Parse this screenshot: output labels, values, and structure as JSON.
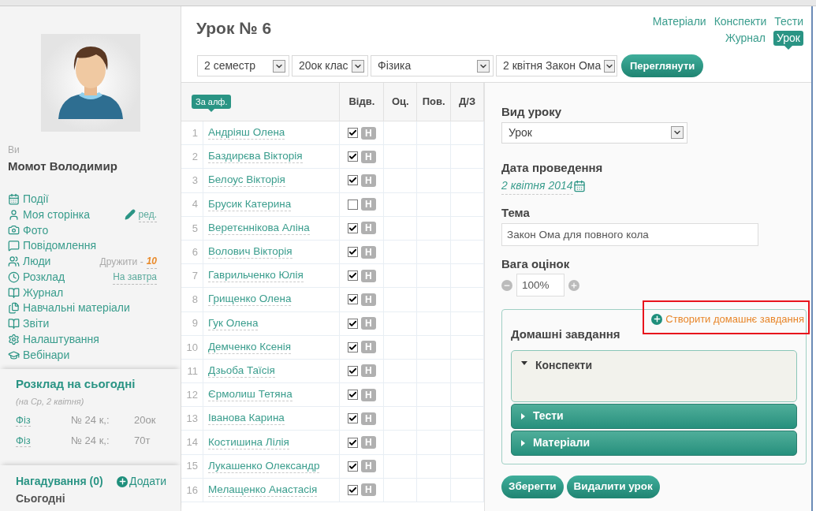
{
  "sidebar": {
    "you_label": "Ви",
    "user_name": "Момот Володимир",
    "menu": [
      {
        "label": "Події",
        "kind": "calendar"
      },
      {
        "label": "Моя сторінка",
        "kind": "person",
        "extra": {
          "kind": "edit",
          "label": "ред."
        }
      },
      {
        "label": "Фото",
        "kind": "camera"
      },
      {
        "label": "Повідомлення",
        "kind": "chat"
      },
      {
        "label": "Люди",
        "kind": "people",
        "extra": {
          "kind": "friends",
          "label": "Дружити -",
          "count": "10"
        }
      },
      {
        "label": "Розклад",
        "kind": "clock",
        "extra": {
          "kind": "link",
          "label": "На завтра"
        }
      },
      {
        "label": "Журнал",
        "kind": "book"
      },
      {
        "label": "Навчальні матеріали",
        "kind": "files"
      },
      {
        "label": "Звіти",
        "kind": "book"
      },
      {
        "label": "Налаштування",
        "kind": "gear"
      },
      {
        "label": "Вебінари",
        "kind": "cap"
      }
    ],
    "schedule": {
      "title": "Розклад на сьогодні",
      "subtitle": "(на Ср, 2 квітня)",
      "rows": [
        {
          "subject": "Фіз",
          "room": "№ 24 к,:",
          "class": "20ок"
        },
        {
          "subject": "Фіз",
          "room": "№ 24 к,:",
          "class": "70т"
        }
      ]
    },
    "reminders": {
      "title": "Нагадування (0)",
      "add": "Додати",
      "today": "Сьогодні"
    }
  },
  "main": {
    "title": "Урок № 6",
    "nav": [
      {
        "label": "Матеріали",
        "selected": false
      },
      {
        "label": "Конспекти",
        "selected": false
      },
      {
        "label": "Тести",
        "selected": false
      },
      {
        "label": "Журнал",
        "selected": false
      },
      {
        "label": "Урок",
        "selected": true
      }
    ],
    "filters": [
      "2 семестр",
      "20ок клас",
      "Фізика",
      "2 квітня Закон Ома"
    ],
    "view_button": "Переглянути"
  },
  "table": {
    "sort_badge": "За алф.",
    "columns": [
      "Відв.",
      "Оц.",
      "Пов.",
      "Д/З"
    ],
    "rows": [
      {
        "number": "1",
        "name": "Андріяш Олена",
        "present": true,
        "absent_badge": "Н"
      },
      {
        "number": "2",
        "name": "Баздирєва Вікторія",
        "present": true,
        "absent_badge": "Н"
      },
      {
        "number": "3",
        "name": "Белоус Вікторія",
        "present": true,
        "absent_badge": "Н"
      },
      {
        "number": "4",
        "name": "Брусик Катерина",
        "present": false,
        "absent_badge": "Н"
      },
      {
        "number": "5",
        "name": "Веретєннікова Аліна",
        "present": true,
        "absent_badge": "Н"
      },
      {
        "number": "6",
        "name": "Волович Вікторія",
        "present": true,
        "absent_badge": "Н"
      },
      {
        "number": "7",
        "name": "Гаврильченко Юлія",
        "present": true,
        "absent_badge": "Н"
      },
      {
        "number": "8",
        "name": "Грищенко Олена",
        "present": true,
        "absent_badge": "Н"
      },
      {
        "number": "9",
        "name": "Гук Олена",
        "present": true,
        "absent_badge": "Н"
      },
      {
        "number": "10",
        "name": "Демченко Ксенія",
        "present": true,
        "absent_badge": "Н"
      },
      {
        "number": "11",
        "name": "Дзьоба Таїсія",
        "present": true,
        "absent_badge": "Н"
      },
      {
        "number": "12",
        "name": "Єрмолиш Тетяна",
        "present": true,
        "absent_badge": "Н"
      },
      {
        "number": "13",
        "name": "Іванова Карина",
        "present": true,
        "absent_badge": "Н"
      },
      {
        "number": "14",
        "name": "Костишина Лілія",
        "present": true,
        "absent_badge": "Н"
      },
      {
        "number": "15",
        "name": "Лукашенко Олександр",
        "present": true,
        "absent_badge": "Н"
      },
      {
        "number": "16",
        "name": "Мелащенко Анастасія",
        "present": true,
        "absent_badge": "Н"
      }
    ]
  },
  "lesson": {
    "type": {
      "label": "Вид уроку",
      "value": "Урок"
    },
    "date": {
      "label": "Дата проведення",
      "value": "2 квітня 2014"
    },
    "topic": {
      "label": "Тема",
      "value": "Закон Ома для повного кола"
    },
    "weight": {
      "label": "Вага оцінок",
      "value": "100%"
    },
    "homework": {
      "title": "Домашні завдання",
      "create": "Створити домашнє завдання",
      "highlighted": true,
      "sections": [
        {
          "label": "Конспекти",
          "expanded": true
        },
        {
          "label": "Тести",
          "expanded": false
        },
        {
          "label": "Матеріали",
          "expanded": false
        }
      ]
    },
    "buttons": [
      "Зберегти",
      "Видалити урок"
    ]
  }
}
